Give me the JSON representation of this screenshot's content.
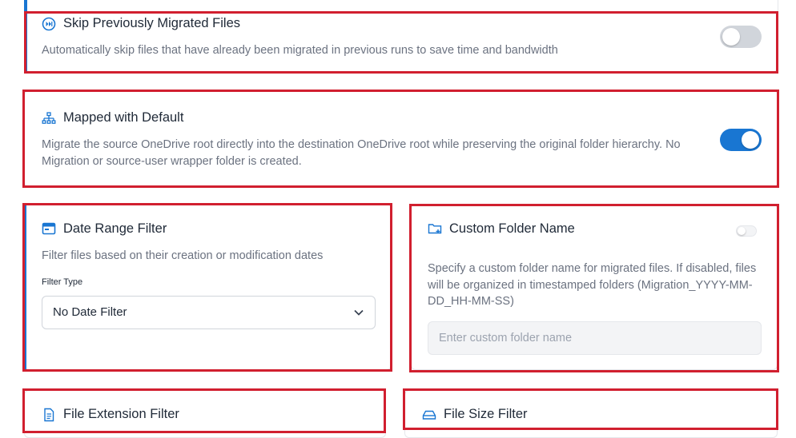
{
  "skip": {
    "title": "Skip Previously Migrated Files",
    "description": "Automatically skip files that have already been migrated in previous runs to save time and bandwidth",
    "enabled": false
  },
  "mapped": {
    "title": "Mapped with Default",
    "description": "Migrate the source OneDrive root directly into the destination OneDrive root while preserving the original folder hierarchy. No Migration or source-user wrapper folder is created.",
    "enabled": true
  },
  "date_range": {
    "title": "Date Range Filter",
    "description": "Filter files based on their creation or modification dates",
    "filter_type_label": "Filter Type",
    "filter_type_value": "No Date Filter"
  },
  "custom_folder": {
    "title": "Custom Folder Name",
    "description": "Specify a custom folder name for migrated files. If disabled, files will be organized in timestamped folders (Migration_YYYY-MM-DD_HH-MM-SS)",
    "placeholder": "Enter custom folder name",
    "enabled": false
  },
  "file_extension": {
    "title": "File Extension Filter"
  },
  "file_size": {
    "title": "File Size Filter"
  },
  "colors": {
    "accent": "#1976d2",
    "highlight": "#d11f2f",
    "left_bar": "#1976d2"
  }
}
